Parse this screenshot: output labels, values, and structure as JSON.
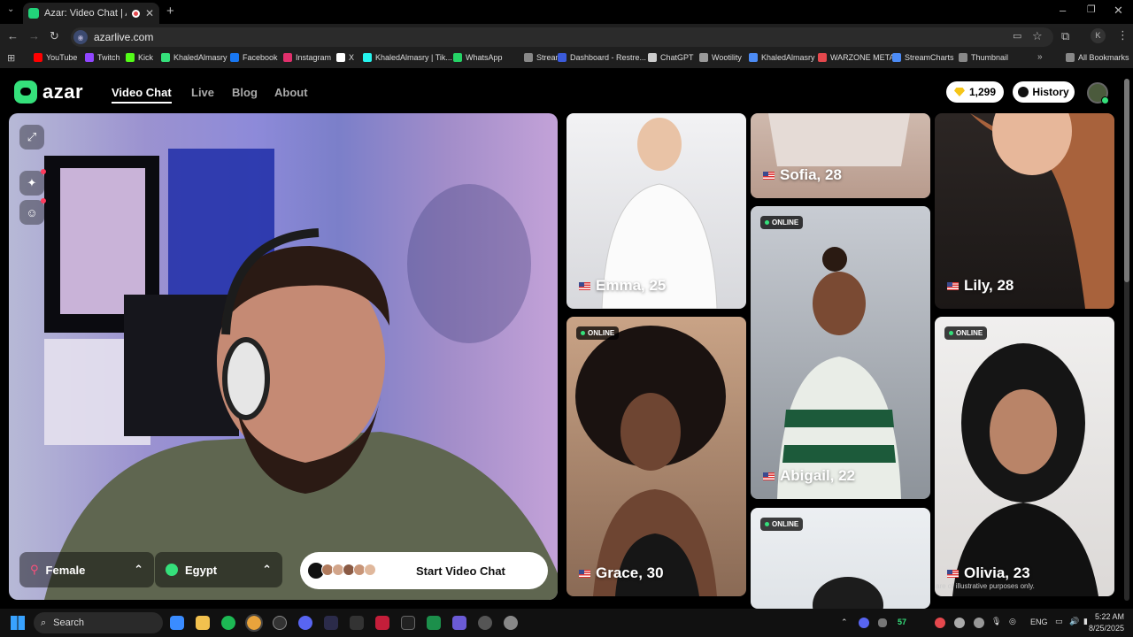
{
  "browser": {
    "tab_title": "Azar: Video Chat | Alternati",
    "url": "azarlive.com",
    "bookmarks": [
      {
        "label": "YouTube",
        "color": "#ff0000"
      },
      {
        "label": "Twitch",
        "color": "#9146ff"
      },
      {
        "label": "Kick",
        "color": "#53fc18"
      },
      {
        "label": "KhaledAlmasry",
        "color": "#35e07b"
      },
      {
        "label": "Facebook",
        "color": "#1877f2"
      },
      {
        "label": "Instagram",
        "color": "#e1306c"
      },
      {
        "label": "X",
        "color": "#ffffff"
      },
      {
        "label": "KhaledAlmasry | Tik...",
        "color": "#25f4ee"
      },
      {
        "label": "WhatsApp",
        "color": "#25d366"
      },
      {
        "label": "Stream",
        "color": "#888888"
      },
      {
        "label": "Dashboard - Restre...",
        "color": "#3b5bdb"
      },
      {
        "label": "ChatGPT",
        "color": "#cccccc"
      },
      {
        "label": "Wootility",
        "color": "#999999"
      },
      {
        "label": "KhaledAlmasry",
        "color": "#4c8bf5"
      },
      {
        "label": "WARZONE META",
        "color": "#e5484d"
      },
      {
        "label": "StreamCharts",
        "color": "#4c8bf5"
      },
      {
        "label": "Thumbnail",
        "color": "#888888"
      }
    ],
    "all_bookmarks": "All Bookmarks"
  },
  "site": {
    "logo": "azar",
    "nav": {
      "video_chat": "Video Chat",
      "live": "Live",
      "blog": "Blog",
      "about": "About"
    },
    "gems": "1,299",
    "history": "History"
  },
  "camera": {
    "gender_filter": "Female",
    "country_filter": "Egypt",
    "start_button": "Start Video Chat"
  },
  "profiles": [
    {
      "label": "Emma, 25",
      "online": false
    },
    {
      "label": "Sofia, 28",
      "online": false
    },
    {
      "label": "Lily, 28",
      "online": false
    },
    {
      "label": "Abigail, 22",
      "online": true
    },
    {
      "label": "Grace, 30",
      "online": true
    },
    {
      "label": "Olivia, 23",
      "online": true
    },
    {
      "label": "",
      "online": true
    }
  ],
  "online_badge": "ONLINE",
  "disclaimer": "are of illustrative purposes only.",
  "taskbar": {
    "search": "Search",
    "badge": "57",
    "lang": "ENG",
    "time": "5:22 AM",
    "date": "8/25/2025"
  },
  "colors": {
    "brand_green": "#35e07b",
    "accent_red": "#ff3b5c"
  }
}
